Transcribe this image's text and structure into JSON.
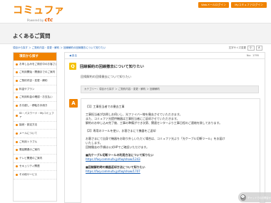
{
  "header": {
    "logo": "コミュファ",
    "logo_powered": "Powered by",
    "logo_brand": "ctc",
    "buttons": [
      "Webメールログイン",
      "Myコミュファログイン"
    ]
  },
  "page_title": "よくあるご質問",
  "breadcrumb": "項目から探す ＞ ご契約内容・変更・解約 ＞ 回線解約の回線撤去について知りたい",
  "font_size": {
    "label": "文字サイズ変更",
    "small": "小",
    "large": "大"
  },
  "sidebar": {
    "heading": "項目から探す",
    "items": [
      "お申し込みをご検討中のお客さま",
      "ご利用開始・開通までのご案内",
      "ご契約内容・変更・解約",
      "料金やプラン",
      "ご利用料金の確認・お支払い",
      "お引越し・移転お手続き",
      "ID・パスワード・Myコミュファ",
      "接続・設定方法",
      "メールについて",
      "ご利用トラブル",
      "電話関連のご案内",
      "テレビ関連のご案内",
      "セキュリティ関連",
      "その他サービス"
    ]
  },
  "main": {
    "back": "◀ 戻る",
    "faq_no": "No：1795",
    "q_label": "Q",
    "question": "回線解約の回線撤去について知りたい",
    "question_sub": "回線解約の回線撤去について知りたい",
    "categories": "カテゴリー：項目から探す ＞ ご契約内容・変更・解約 ＞ 回線解約",
    "a_label": "A",
    "answer_lines": [
      "【1】工事担当者での撤去工事",
      "",
      "工事担当者が訪問しお伺いし、光ファイバー線を撤去させていただきます。",
      "また、コミュファ光提供機器は工事担当者にご返却させていただきます。",
      "解約のお申し込み完了後、工事の準備ができ次第、関連センターより工事日程のご連絡を致しております。",
      "",
      "【2】専用のツールを使い、お客さまにて機器をご返却",
      "",
      "お客さまにて自身で機器をお取り外しいただく場合は、コミュファ光より「光ケーブル切断ツール」をお届け",
      "いたします。",
      "回線撤去の手順は公式HPでご確認いただけます。"
    ],
    "links": [
      {
        "title": "■光ケーブル切断ツールの利用方法について知りたい",
        "url": "https://faq.commufa.jp/faq/show/1243"
      },
      {
        "title": "■回線解約時の機器返却方法について知りたい",
        "url": "https://faq.commufa.jp/faq/show/1707"
      }
    ]
  },
  "chat": {
    "label": "チャットでのお問合せ"
  }
}
